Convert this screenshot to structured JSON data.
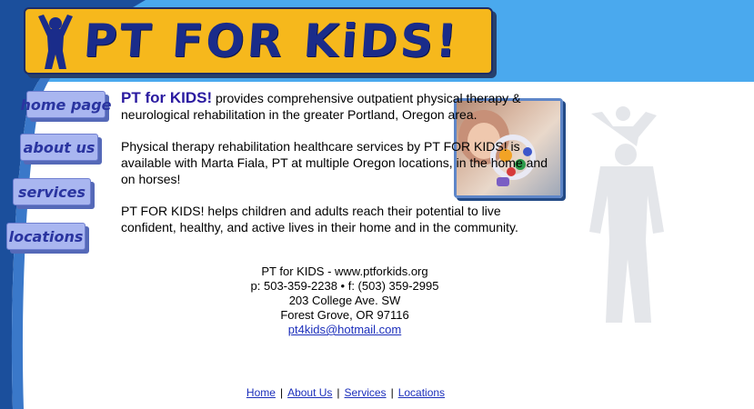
{
  "header": {
    "logo_text": "PT FOR KiDS!"
  },
  "nav": {
    "home": "home page",
    "about": "about us",
    "services": "services",
    "locations": "locations"
  },
  "intro": {
    "brand": "PT for KIDS!",
    "p1_rest": " provides comprehensive outpatient physical therapy & neurological rehabilitation in the greater Portland, Oregon area.",
    "p2": "Physical therapy rehabilitation healthcare services by PT FOR KIDS! is available with Marta Fiala, PT at multiple Oregon locations, in the home and on horses!",
    "p3": "PT FOR KIDS! helps children and adults reach their potential to live confident, healthy, and active lives in their home and in the community."
  },
  "contact": {
    "line1": "PT for KIDS - www.ptforkids.org",
    "line2": "p: 503-359-2238 • f: (503) 359-2995",
    "line3": "203 College Ave. SW",
    "line4": "Forest Grove, OR 97116",
    "email": "pt4kids@hotmail.com"
  },
  "footer": {
    "home": "Home",
    "about": "About Us",
    "services": "Services",
    "locations": "Locations",
    "separator": "|"
  },
  "colors": {
    "band": "#4aa9ee",
    "swoosh": "#1b4f9c",
    "logo_bg": "#f6b81c",
    "logo_text": "#1a2c8a",
    "button_bg": "#a9b6f0",
    "button_text": "#2a34a0",
    "link": "#1c2fbb"
  }
}
